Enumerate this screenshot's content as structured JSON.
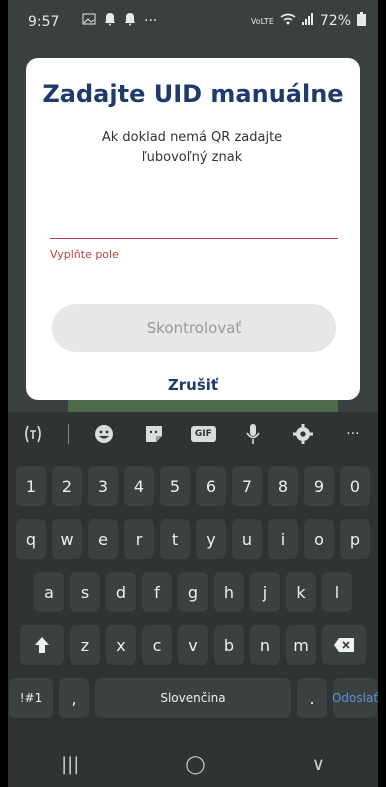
{
  "status_bar": {
    "time": "9:57",
    "left_icons": [
      "image-icon",
      "notification-bell-icon",
      "notification-bell-icon",
      "more-dots-icon"
    ],
    "battery": "72%",
    "network_label": "VoLTE"
  },
  "dialog": {
    "title": "Zadajte UID manuálne",
    "subtitle": "Ak doklad nemá QR zadajte ľubovoľný znak",
    "input_value": "",
    "error": "Vyplňte pole",
    "check_button": "Skontrolovať",
    "cancel_button": "Zrušiť"
  },
  "keyboard": {
    "toolbar_icons": [
      "translate-icon",
      "emoji-icon",
      "sticker-icon",
      "gif-icon",
      "microphone-icon",
      "settings-icon",
      "more-icon"
    ],
    "gif_label": "GIF",
    "more_label": "···",
    "rows": {
      "numbers": [
        "1",
        "2",
        "3",
        "4",
        "5",
        "6",
        "7",
        "8",
        "9",
        "0"
      ],
      "row1": [
        "q",
        "w",
        "e",
        "r",
        "t",
        "y",
        "u",
        "i",
        "o",
        "p"
      ],
      "row2": [
        "a",
        "s",
        "d",
        "f",
        "g",
        "h",
        "j",
        "k",
        "l"
      ],
      "row3": [
        "z",
        "x",
        "c",
        "v",
        "b",
        "n",
        "m"
      ]
    },
    "shift_icon": "shift-arrow-icon",
    "backspace_icon": "backspace-icon",
    "symbols_label": "!#1",
    "comma_label": ",",
    "space_label": "Slovenčina",
    "period_label": ".",
    "action_label": "Odoslať"
  },
  "navigation": {
    "recent_label": "|||",
    "home_label": "◯",
    "back_label": "∨"
  }
}
